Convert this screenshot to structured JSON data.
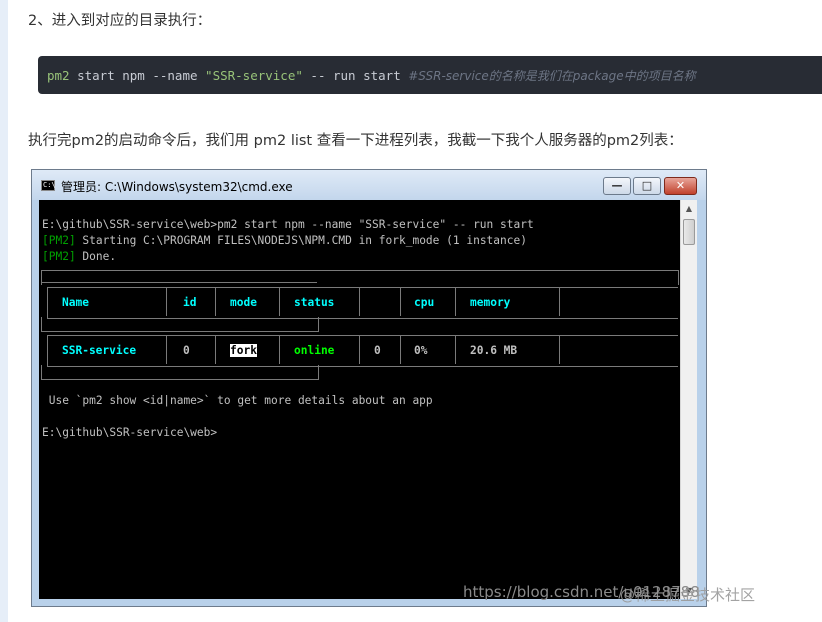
{
  "article": {
    "step_heading": "2、进入到对应的目录执行：",
    "code": {
      "pm2": "pm2",
      "start_npm": " start npm --name ",
      "name_str": "\"SSR-service\"",
      "run_start": " -- run start  ",
      "comment": "#SSR-service的名称是我们在package中的项目名称"
    },
    "paragraph": "执行完pm2的启动命令后，我们用 pm2 list 查看一下进程列表，我截一下我个人服务器的pm2列表："
  },
  "window": {
    "title": "管理员: C:\\Windows\\system32\\cmd.exe",
    "icon_text": "C:\\",
    "minimize_glyph": "—",
    "maximize_glyph": "□",
    "close_glyph": "✕"
  },
  "console": {
    "line1": "E:\\github\\SSR-service\\web>pm2 start npm --name \"SSR-service\" -- run start",
    "line2_tag": "[PM2]",
    "line2_text": " Starting C:\\PROGRAM FILES\\NODEJS\\NPM.CMD in fork_mode (1 instance)",
    "line3_tag": "[PM2]",
    "line3_text": " Done.",
    "table": {
      "headers": [
        "Name",
        "id",
        "mode",
        "status",
        "",
        "cpu",
        "memory"
      ],
      "row": {
        "name": "SSR-service",
        "id": "0",
        "mode": "fork",
        "status": "online",
        "restart": "0",
        "cpu": "0%",
        "memory": "20.6 MB"
      }
    },
    "hint": " Use `pm2 show <id|name>` to get more details about an app",
    "prompt": "E:\\github\\SSR-service\\web>"
  },
  "watermark": {
    "url": "https://blog.csdn.net/u0128788",
    "site": "@稀土掘金技术社区"
  }
}
